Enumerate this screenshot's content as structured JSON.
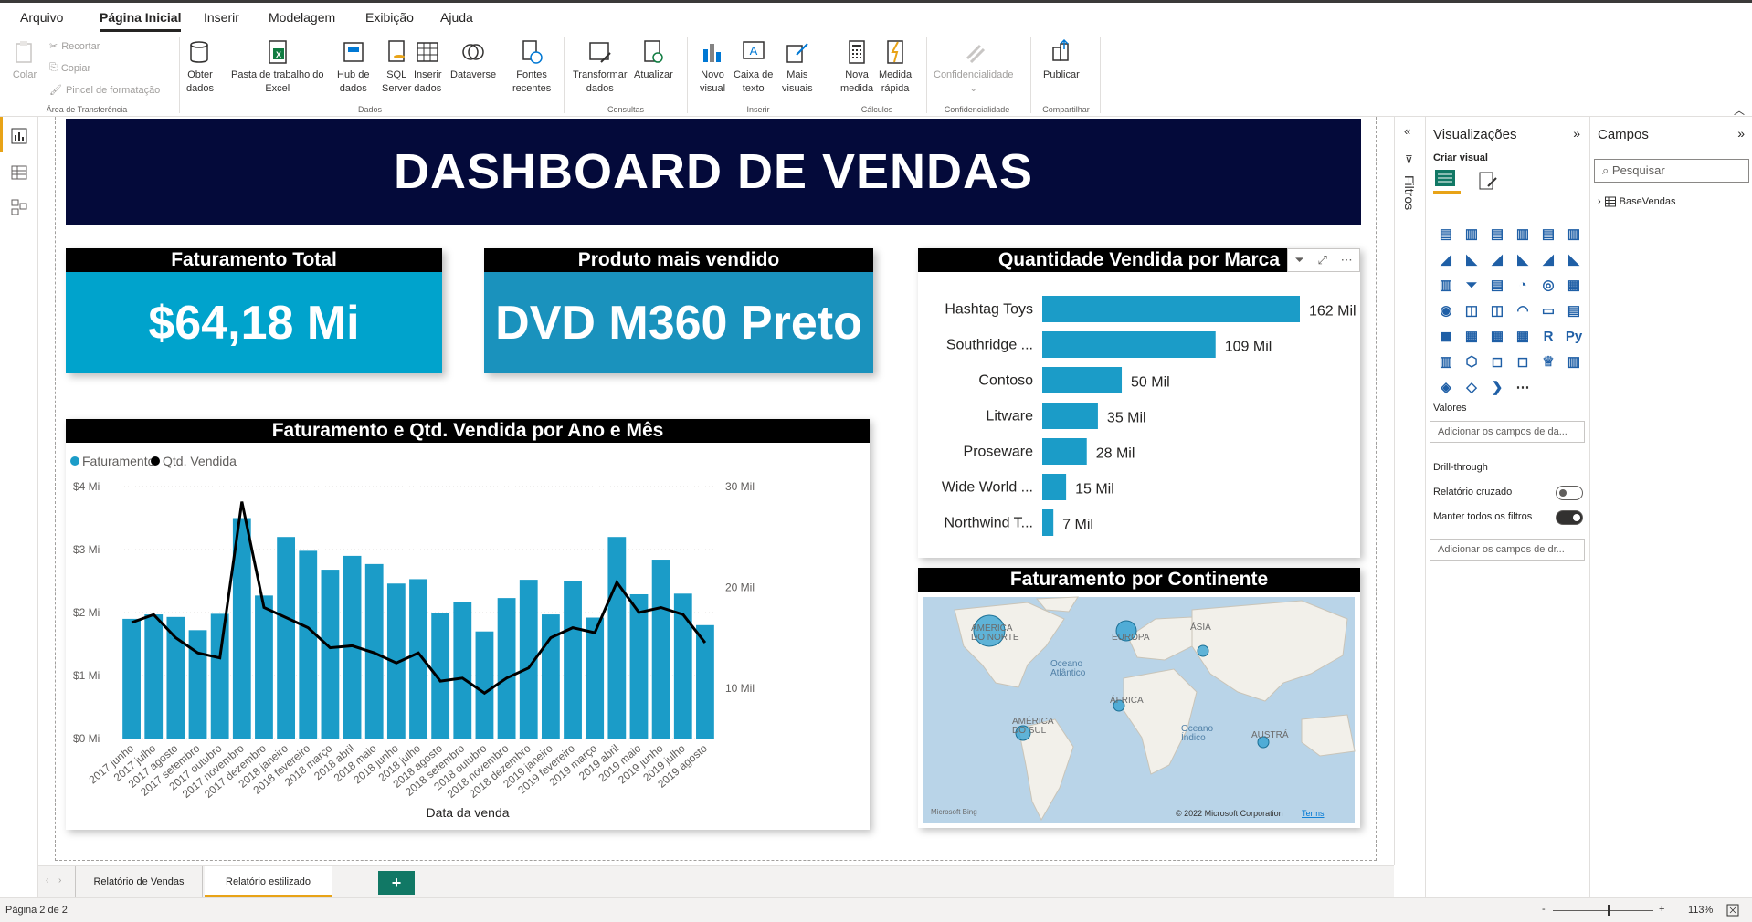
{
  "menu": [
    "Arquivo",
    "Página Inicial",
    "Inserir",
    "Modelagem",
    "Exibição",
    "Ajuda"
  ],
  "ribbon": {
    "clipboard": {
      "paste": "Colar",
      "cut": "Recortar",
      "copy": "Copiar",
      "format_painter": "Pincel de formatação",
      "group": "Área de Transferência"
    },
    "data": {
      "get_data": [
        "Obter",
        "dados"
      ],
      "excel": [
        "Pasta de trabalho do",
        "Excel"
      ],
      "datahub": [
        "Hub de",
        "dados"
      ],
      "sql": [
        "SQL",
        "Server"
      ],
      "insert_data": [
        "Inserir",
        "dados"
      ],
      "dataverse": "Dataverse",
      "recent": [
        "Fontes",
        "recentes"
      ],
      "group": "Dados"
    },
    "queries": {
      "transform": [
        "Transformar",
        "dados"
      ],
      "refresh": "Atualizar",
      "group": "Consultas"
    },
    "insert": {
      "new_visual": [
        "Novo",
        "visual"
      ],
      "text_box": [
        "Caixa de",
        "texto"
      ],
      "more_visuals": [
        "Mais",
        "visuais"
      ],
      "group": "Inserir"
    },
    "calc": {
      "new_measure": [
        "Nova",
        "medida"
      ],
      "quick_measure": [
        "Medida",
        "rápida"
      ],
      "group": "Cálculos"
    },
    "sensitivity": {
      "label": "Confidencialidade",
      "group": "Confidencialidade"
    },
    "share": {
      "publish": "Publicar",
      "group": "Compartilhar"
    }
  },
  "dashboard": {
    "title": "DASHBOARD DE VENDAS",
    "kpi_revenue": {
      "header": "Faturamento Total",
      "value": "$64,18 Mi"
    },
    "kpi_product": {
      "header": "Produto mais vendido",
      "value": "DVD M360 Preto"
    },
    "combo_title": "Faturamento e Qtd. Vendida por Ano e Mês",
    "bar_title": "Quantidade Vendida por Marca",
    "map_title": "Faturamento por Continente",
    "map_labels": {
      "na": "AMÉRICA\nDO NORTE",
      "eu": "EUROPA",
      "as": "ÁSIA",
      "af": "ÁFRICA",
      "sa": "AMÉRICA\nDO SUL",
      "au": "AUSTRÁ",
      "atl": "Oceano\nAtlântico",
      "ind": "Oceano\nÍndico",
      "bing": "Microsoft Bing",
      "copy": "© 2022 Microsoft Corporation",
      "terms": "Terms"
    }
  },
  "chart_data": [
    {
      "type": "bar+line",
      "title": "Faturamento e Qtd. Vendida por Ano e Mês",
      "xlabel": "Data da venda",
      "legend": [
        "Faturamento",
        "Qtd. Vendida"
      ],
      "legend_position": "top-left",
      "categories": [
        "2017 junho",
        "2017 julho",
        "2017 agosto",
        "2017 setembro",
        "2017 outubro",
        "2017 novembro",
        "2017 dezembro",
        "2018 janeiro",
        "2018 fevereiro",
        "2018 março",
        "2018 abril",
        "2018 maio",
        "2018 junho",
        "2018 julho",
        "2018 agosto",
        "2018 setembro",
        "2018 outubro",
        "2018 novembro",
        "2018 dezembro",
        "2019 janeiro",
        "2019 fevereiro",
        "2019 março",
        "2019 abril",
        "2019 maio",
        "2019 junho",
        "2019 julho",
        "2019 agosto"
      ],
      "series": [
        {
          "name": "Faturamento",
          "axis": "left",
          "unit": "Mi",
          "values": [
            1.9,
            1.97,
            1.93,
            1.72,
            1.98,
            3.5,
            2.27,
            3.2,
            2.98,
            2.68,
            2.9,
            2.77,
            2.46,
            2.53,
            2.0,
            2.17,
            1.7,
            2.23,
            2.52,
            1.97,
            2.5,
            1.92,
            3.2,
            2.29,
            2.84,
            2.3,
            1.8
          ]
        },
        {
          "name": "Qtd. Vendida",
          "axis": "right",
          "unit": "Mil",
          "values": [
            16.5,
            17.3,
            15.0,
            13.5,
            13.0,
            28.5,
            18.0,
            17.0,
            16.0,
            14.0,
            14.2,
            13.5,
            12.5,
            13.5,
            10.7,
            11.0,
            9.5,
            11.0,
            12.0,
            15.0,
            16.0,
            15.5,
            20.5,
            17.5,
            18.0,
            17.3,
            14.5
          ]
        }
      ],
      "ylim_left": [
        0,
        4
      ],
      "yticks_left": [
        "$0 Mi",
        "$1 Mi",
        "$2 Mi",
        "$3 Mi",
        "$4 Mi"
      ],
      "ylim_right": [
        5,
        30
      ],
      "yticks_right": [
        "10 Mil",
        "20 Mil",
        "30 Mil"
      ],
      "colors": {
        "bar": "#1b9cc8",
        "line": "#000000"
      }
    },
    {
      "type": "bar",
      "orientation": "horizontal",
      "title": "Quantidade Vendida por Marca",
      "categories": [
        "Hashtag Toys",
        "Southridge ...",
        "Contoso",
        "Litware",
        "Proseware",
        "Wide World ...",
        "Northwind T..."
      ],
      "values": [
        162,
        109,
        50,
        35,
        28,
        15,
        7
      ],
      "value_labels": [
        "162 Mil",
        "109 Mil",
        "50 Mil",
        "35 Mil",
        "28 Mil",
        "15 Mil",
        "7 Mil"
      ],
      "unit": "Mil",
      "color": "#1b9cc8"
    }
  ],
  "viz_pane": {
    "title": "Visualizações",
    "create": "Criar visual",
    "values": "Valores",
    "add_fields": "Adicionar os campos de da...",
    "drill": "Drill-through",
    "cross": "Relatório cruzado",
    "keep": "Manter todos os filtros",
    "add_drill": "Adicionar os campos de dr..."
  },
  "filters_label": "Filtros",
  "fields_pane": {
    "title": "Campos",
    "search": "Pesquisar",
    "table": "BaseVendas"
  },
  "tabs": [
    "Relatório de Vendas",
    "Relatório estilizado"
  ],
  "status": {
    "page": "Página 2 de 2",
    "zoom": "113%",
    "minus": "-",
    "plus": "+"
  },
  "colors": {
    "accent": "#1b9cc8",
    "kpi1": "#00a3cc",
    "kpi2": "#1a92bd",
    "banner": "#040a3a"
  }
}
